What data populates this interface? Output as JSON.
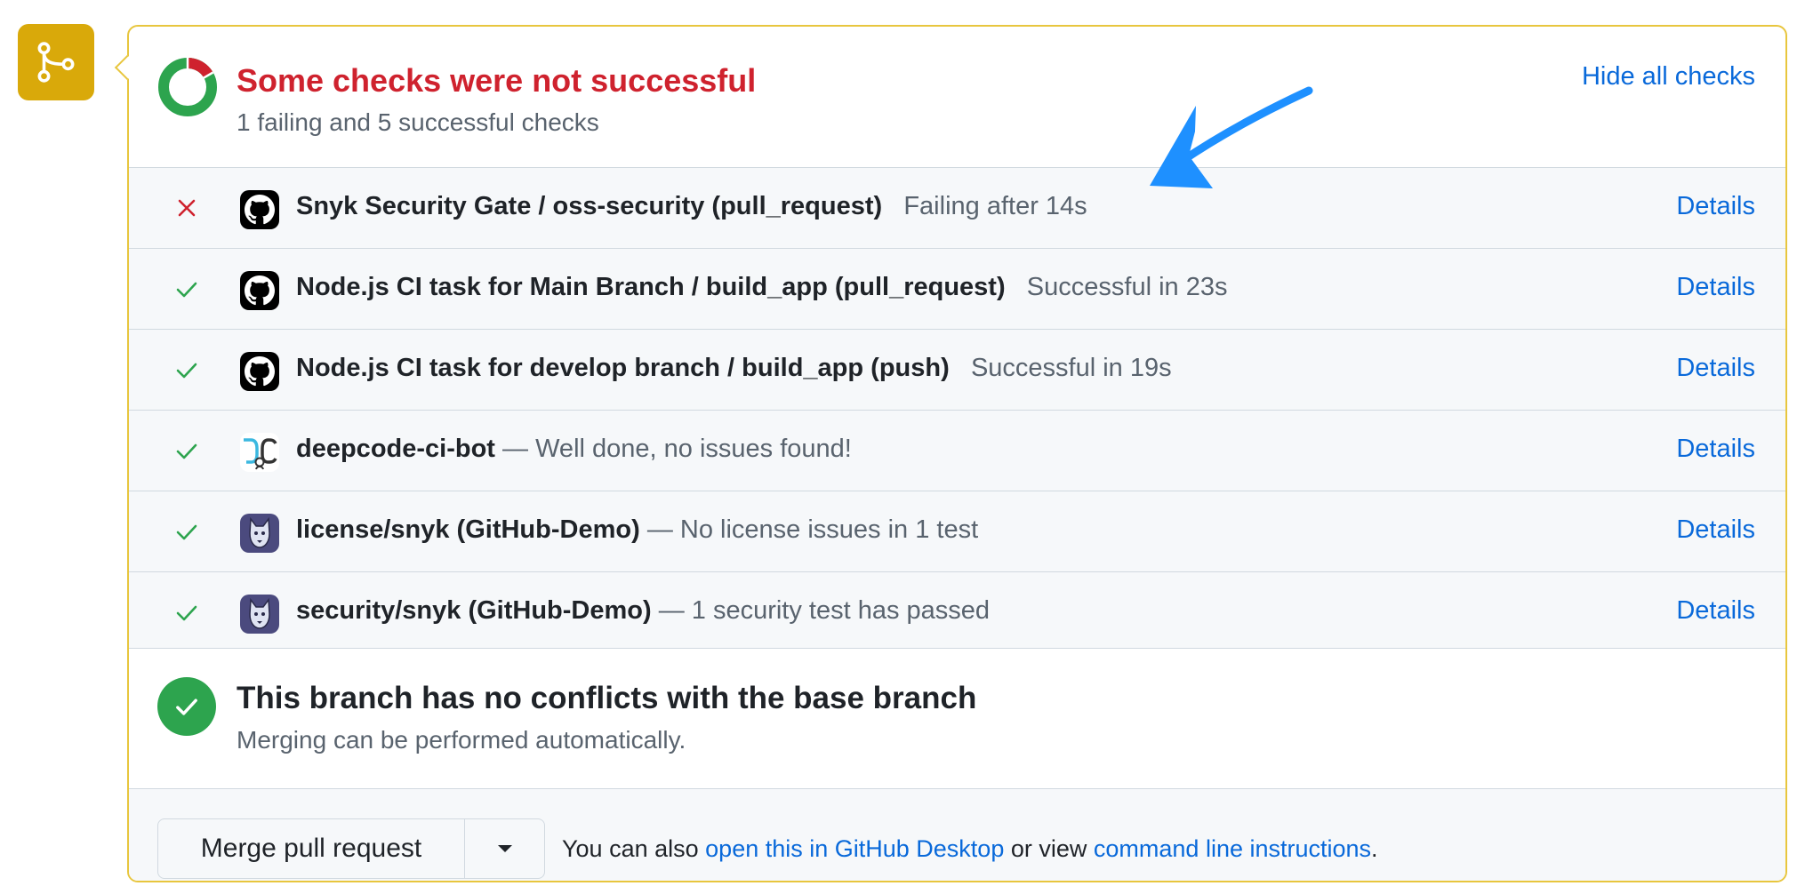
{
  "header": {
    "title": "Some checks were not successful",
    "subtitle": "1 failing and 5 successful checks",
    "hide_checks_label": "Hide all checks"
  },
  "checks": [
    {
      "status": "failing",
      "avatar": "github-icon",
      "name": "Snyk Security Gate / oss-security (pull_request)",
      "detail": "Failing after 14s",
      "details_label": "Details"
    },
    {
      "status": "success",
      "avatar": "github-icon",
      "name": "Node.js CI task for Main Branch / build_app (pull_request)",
      "detail": "Successful in 23s",
      "details_label": "Details"
    },
    {
      "status": "success",
      "avatar": "github-icon",
      "name": "Node.js CI task for develop branch / build_app (push)",
      "detail": "Successful in 19s",
      "details_label": "Details"
    },
    {
      "status": "success",
      "avatar": "deepcode-icon",
      "name": "deepcode-ci-bot",
      "detail": "— Well done, no issues found!",
      "details_label": "Details"
    },
    {
      "status": "success",
      "avatar": "snyk-icon",
      "name": "license/snyk (GitHub-Demo)",
      "detail": "— No license issues in 1 test",
      "details_label": "Details"
    },
    {
      "status": "success",
      "avatar": "snyk-icon",
      "name": "security/snyk (GitHub-Demo)",
      "detail": "— 1 security test has passed",
      "details_label": "Details"
    }
  ],
  "conflict": {
    "title": "This branch has no conflicts with the base branch",
    "subtitle": "Merging can be performed automatically."
  },
  "merge": {
    "button_label": "Merge pull request",
    "note_prefix": "You can also",
    "desktop_link": "open this in GitHub Desktop",
    "note_middle": "or view",
    "cli_link": "command line instructions",
    "note_suffix": "."
  },
  "colors": {
    "failure": "#cf222e",
    "success": "#2da44e",
    "link": "#0969da",
    "merge_badge": "#d9a90a",
    "annotation_arrow": "#1e90ff"
  }
}
